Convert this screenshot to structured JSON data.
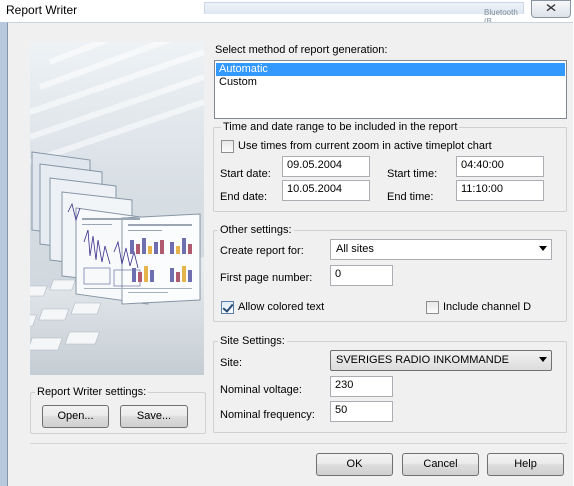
{
  "window": {
    "title": "Report Writer",
    "close_glyph": "✕",
    "background_tab_text": "Bluetooth (B..."
  },
  "method": {
    "label": "Select method of report generation:",
    "options": [
      "Automatic",
      "Custom"
    ],
    "selected": "Automatic"
  },
  "time_range": {
    "legend": "Time and date range to be included in the report",
    "use_zoom_label": "Use times from current zoom in active timeplot chart",
    "use_zoom_checked": false,
    "start_date_label": "Start date:",
    "start_date": "09.05.2004",
    "start_time_label": "Start time:",
    "start_time": "04:40:00",
    "end_date_label": "End date:",
    "end_date": "10.05.2004",
    "end_time_label": "End time:",
    "end_time": "11:10:00"
  },
  "other": {
    "legend": "Other settings:",
    "create_for_label": "Create report for:",
    "create_for_value": "All sites",
    "first_page_label": "First page number:",
    "first_page_value": "0",
    "colored_text_label": "Allow colored text",
    "colored_text_checked": true,
    "include_channel_label": "Include channel D",
    "include_channel_checked": false
  },
  "site": {
    "legend": "Site Settings:",
    "site_label": "Site:",
    "site_value": "SVERIGES RADIO INKOMMANDE",
    "voltage_label": "Nominal voltage:",
    "voltage_value": "230",
    "frequency_label": "Nominal frequency:",
    "frequency_value": "50"
  },
  "report_writer_settings": {
    "legend": "Report Writer settings:",
    "open_label": "Open...",
    "save_label": "Save..."
  },
  "footer": {
    "ok_label": "OK",
    "cancel_label": "Cancel",
    "help_label": "Help"
  },
  "colors": {
    "selection": "#3399ff",
    "dialog_bg": "#f0f0f0",
    "frame": "#b7c8dc"
  },
  "icons": {
    "close": "close-icon",
    "dropdown": "chevron-down-icon",
    "checkmark": "checkmark-icon"
  }
}
